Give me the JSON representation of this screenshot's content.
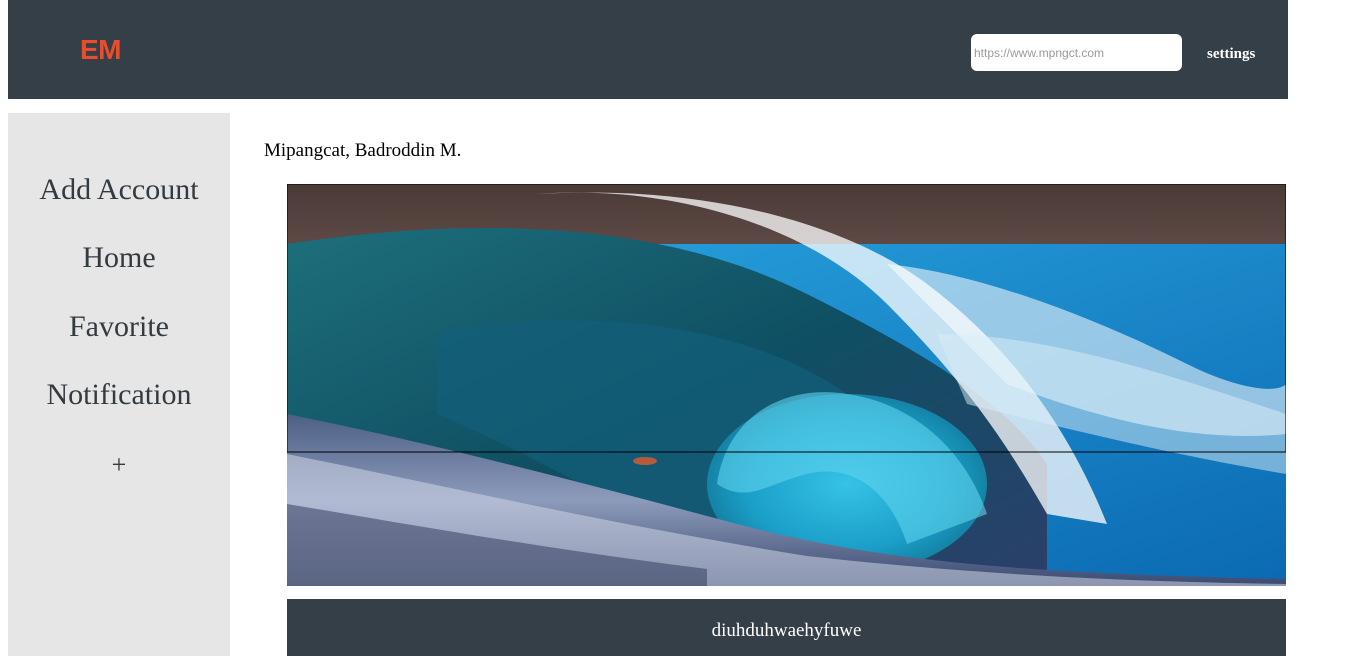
{
  "header": {
    "logo": "EM",
    "url_placeholder": "https://www.mpngct.com",
    "settings_label": "settings"
  },
  "sidebar": {
    "items": [
      {
        "label": "Add Account"
      },
      {
        "label": "Home"
      },
      {
        "label": "Favorite"
      },
      {
        "label": "Notification"
      }
    ],
    "add_label": "+"
  },
  "main": {
    "author_name": "Mipangcat, Badroddin M.",
    "caption": "diuhduhwaehyfuwe"
  },
  "colors": {
    "header_bg": "#353f47",
    "logo": "#e84e2b",
    "sidebar_bg": "#e6e6e6"
  }
}
